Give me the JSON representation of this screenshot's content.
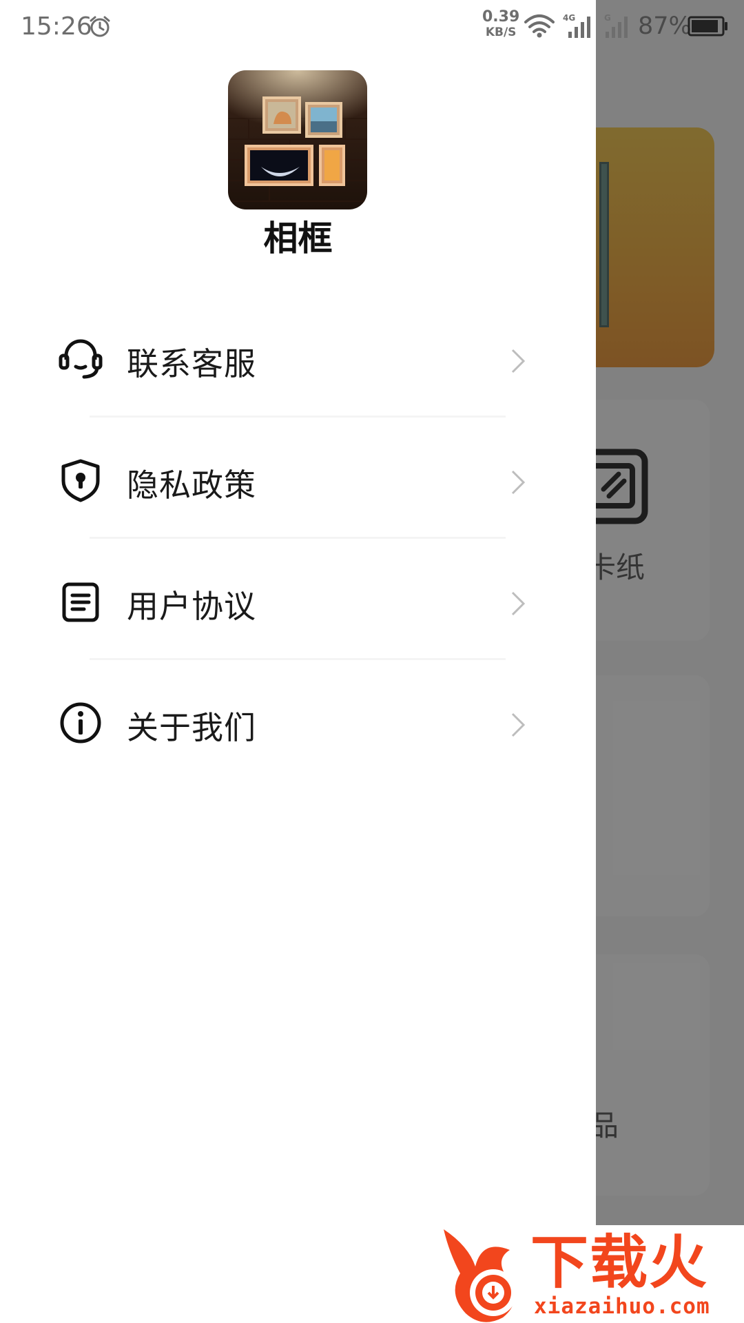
{
  "status_bar": {
    "time": "15:26",
    "net_speed_value": "0.39",
    "net_speed_unit": "KB/S",
    "network_1": "4G",
    "network_2": "G",
    "battery": "87%"
  },
  "background": {
    "wallpaper_label_fragment": "卡纸",
    "bottom_label_fragment": "品"
  },
  "drawer": {
    "app_name": "相框",
    "menu": [
      {
        "label": "联系客服",
        "icon": "headset-icon"
      },
      {
        "label": "隐私政策",
        "icon": "shield-icon"
      },
      {
        "label": "用户协议",
        "icon": "document-icon"
      },
      {
        "label": "关于我们",
        "icon": "info-icon"
      }
    ]
  },
  "watermark": {
    "title": "下载火",
    "url": "xiazaihuo.com"
  },
  "colors": {
    "watermark": "#f2461d",
    "banner": "#f0a52a",
    "text": "#1a1a1a"
  }
}
